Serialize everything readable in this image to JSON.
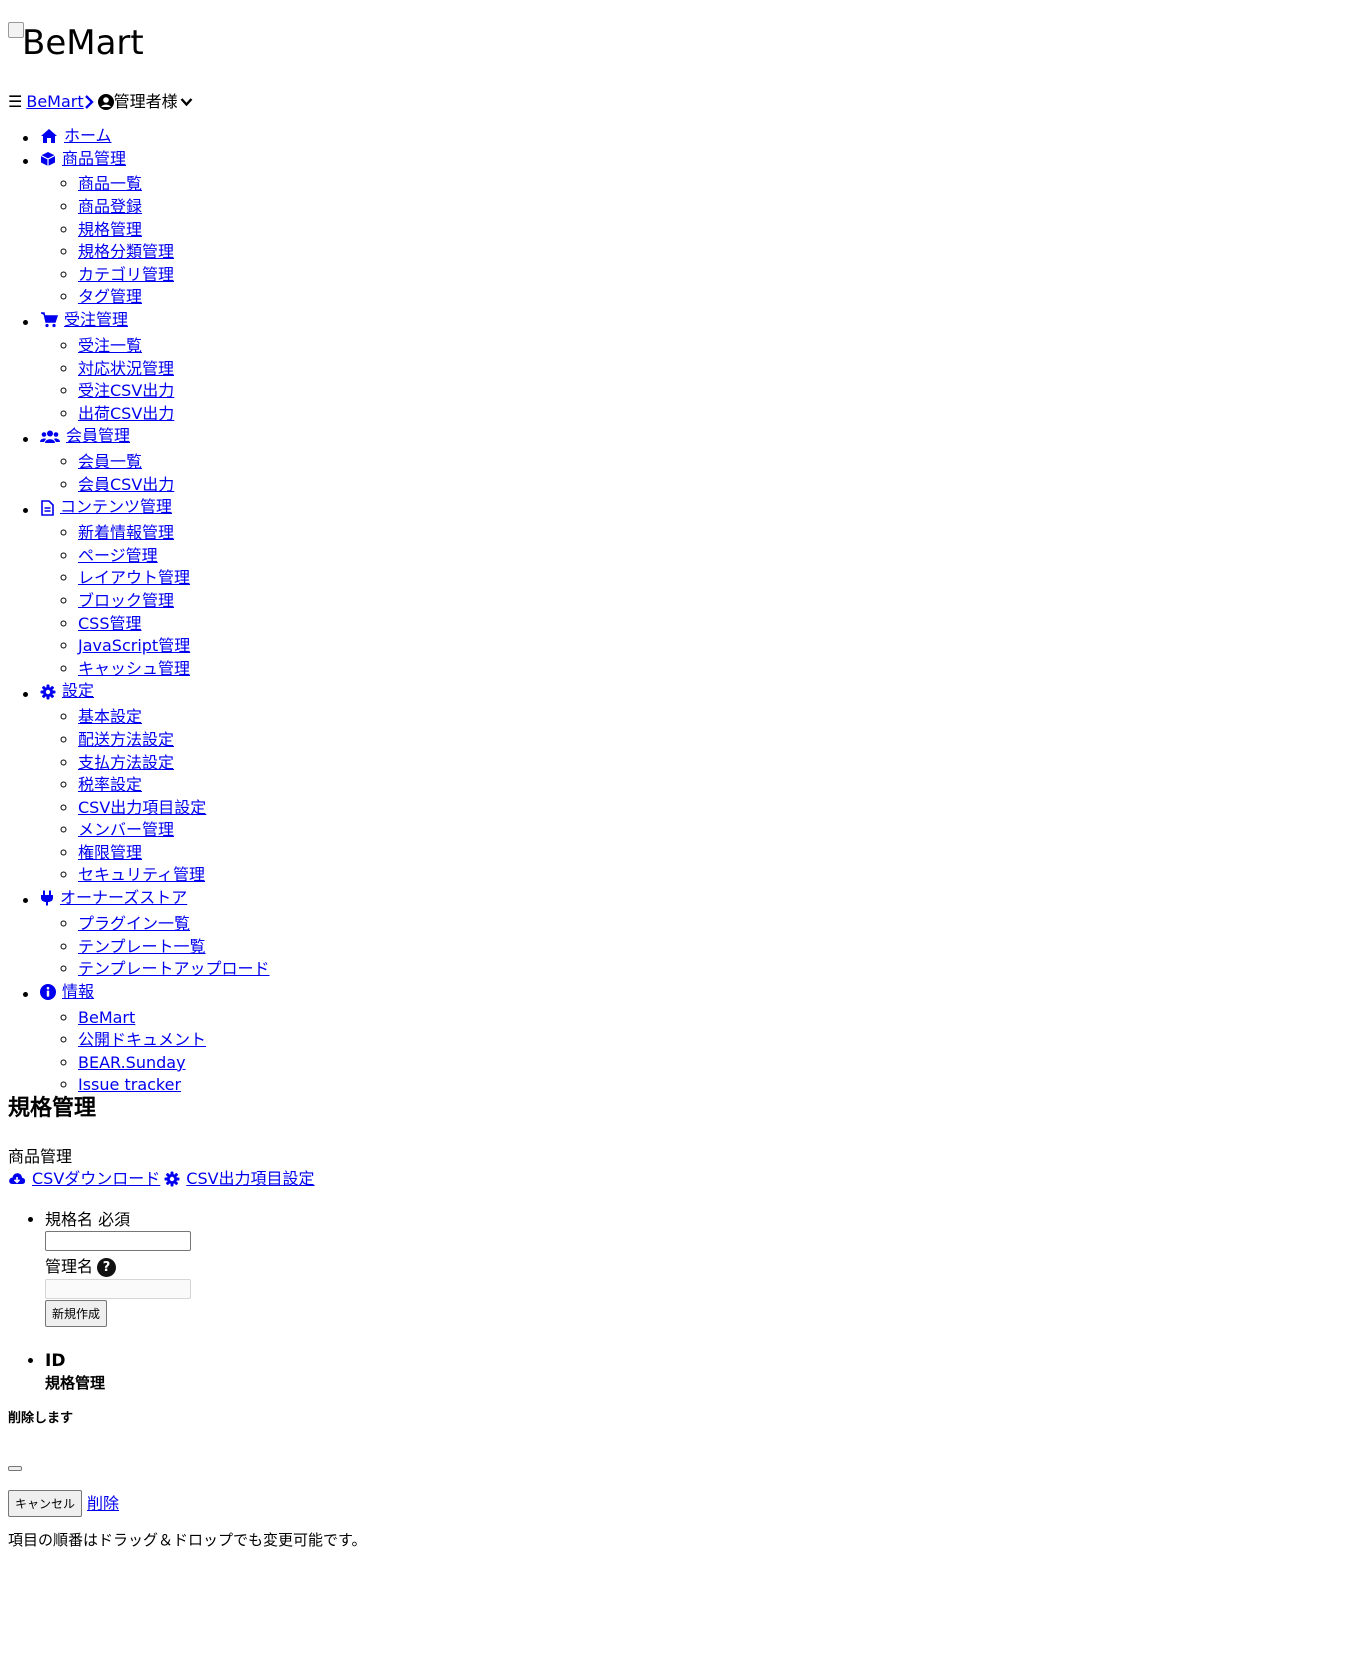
{
  "brand": {
    "logo_alt": "BeMart"
  },
  "header": {
    "hamburger": "☰",
    "home_link": "BeMart",
    "user_name": "管理者",
    "user_suffix": " 様"
  },
  "nav": {
    "home": "ホーム",
    "product": {
      "label": "商品管理",
      "items": [
        "商品一覧",
        "商品登録",
        "規格管理",
        "規格分類管理",
        "カテゴリ管理",
        "タグ管理"
      ]
    },
    "order": {
      "label": "受注管理",
      "items": [
        "受注一覧",
        "対応状況管理",
        "受注CSV出力",
        "出荷CSV出力"
      ]
    },
    "member": {
      "label": "会員管理",
      "items": [
        "会員一覧",
        "会員CSV出力"
      ]
    },
    "content": {
      "label": "コンテンツ管理",
      "items": [
        "新着情報管理",
        "ページ管理",
        "レイアウト管理",
        "ブロック管理",
        "CSS管理",
        "JavaScript管理",
        "キャッシュ管理"
      ]
    },
    "settings": {
      "label": "設定",
      "items": [
        "基本設定",
        "配送方法設定",
        "支払方法設定",
        "税率設定",
        "CSV出力項目設定",
        "メンバー管理",
        "権限管理",
        "セキュリティ管理"
      ]
    },
    "store": {
      "label": "オーナーズストア",
      "items": [
        "プラグイン一覧",
        "テンプレート一覧",
        "テンプレートアップロード"
      ]
    },
    "info": {
      "label": "情報",
      "items": [
        "BeMart",
        "公開ドキュメント",
        "BEAR.Sunday",
        "Issue tracker"
      ]
    }
  },
  "page": {
    "title": "規格管理",
    "section": "商品管理",
    "csv_download": "CSVダウンロード",
    "csv_settings": "CSV出力項目設定"
  },
  "form": {
    "name_label": "規格名",
    "required": "必須",
    "name_value": "",
    "admin_label": "管理名",
    "help": "?",
    "admin_value": "",
    "create_button": "新規作成",
    "col_id": "ID",
    "col_name": "規格管理"
  },
  "modal": {
    "title": "削除します",
    "cancel": "キャンセル",
    "delete": "削除"
  },
  "note": "項目の順番はドラッグ＆ドロップでも変更可能です。",
  "colors": {
    "link": "#0000ee",
    "text": "#000000"
  }
}
